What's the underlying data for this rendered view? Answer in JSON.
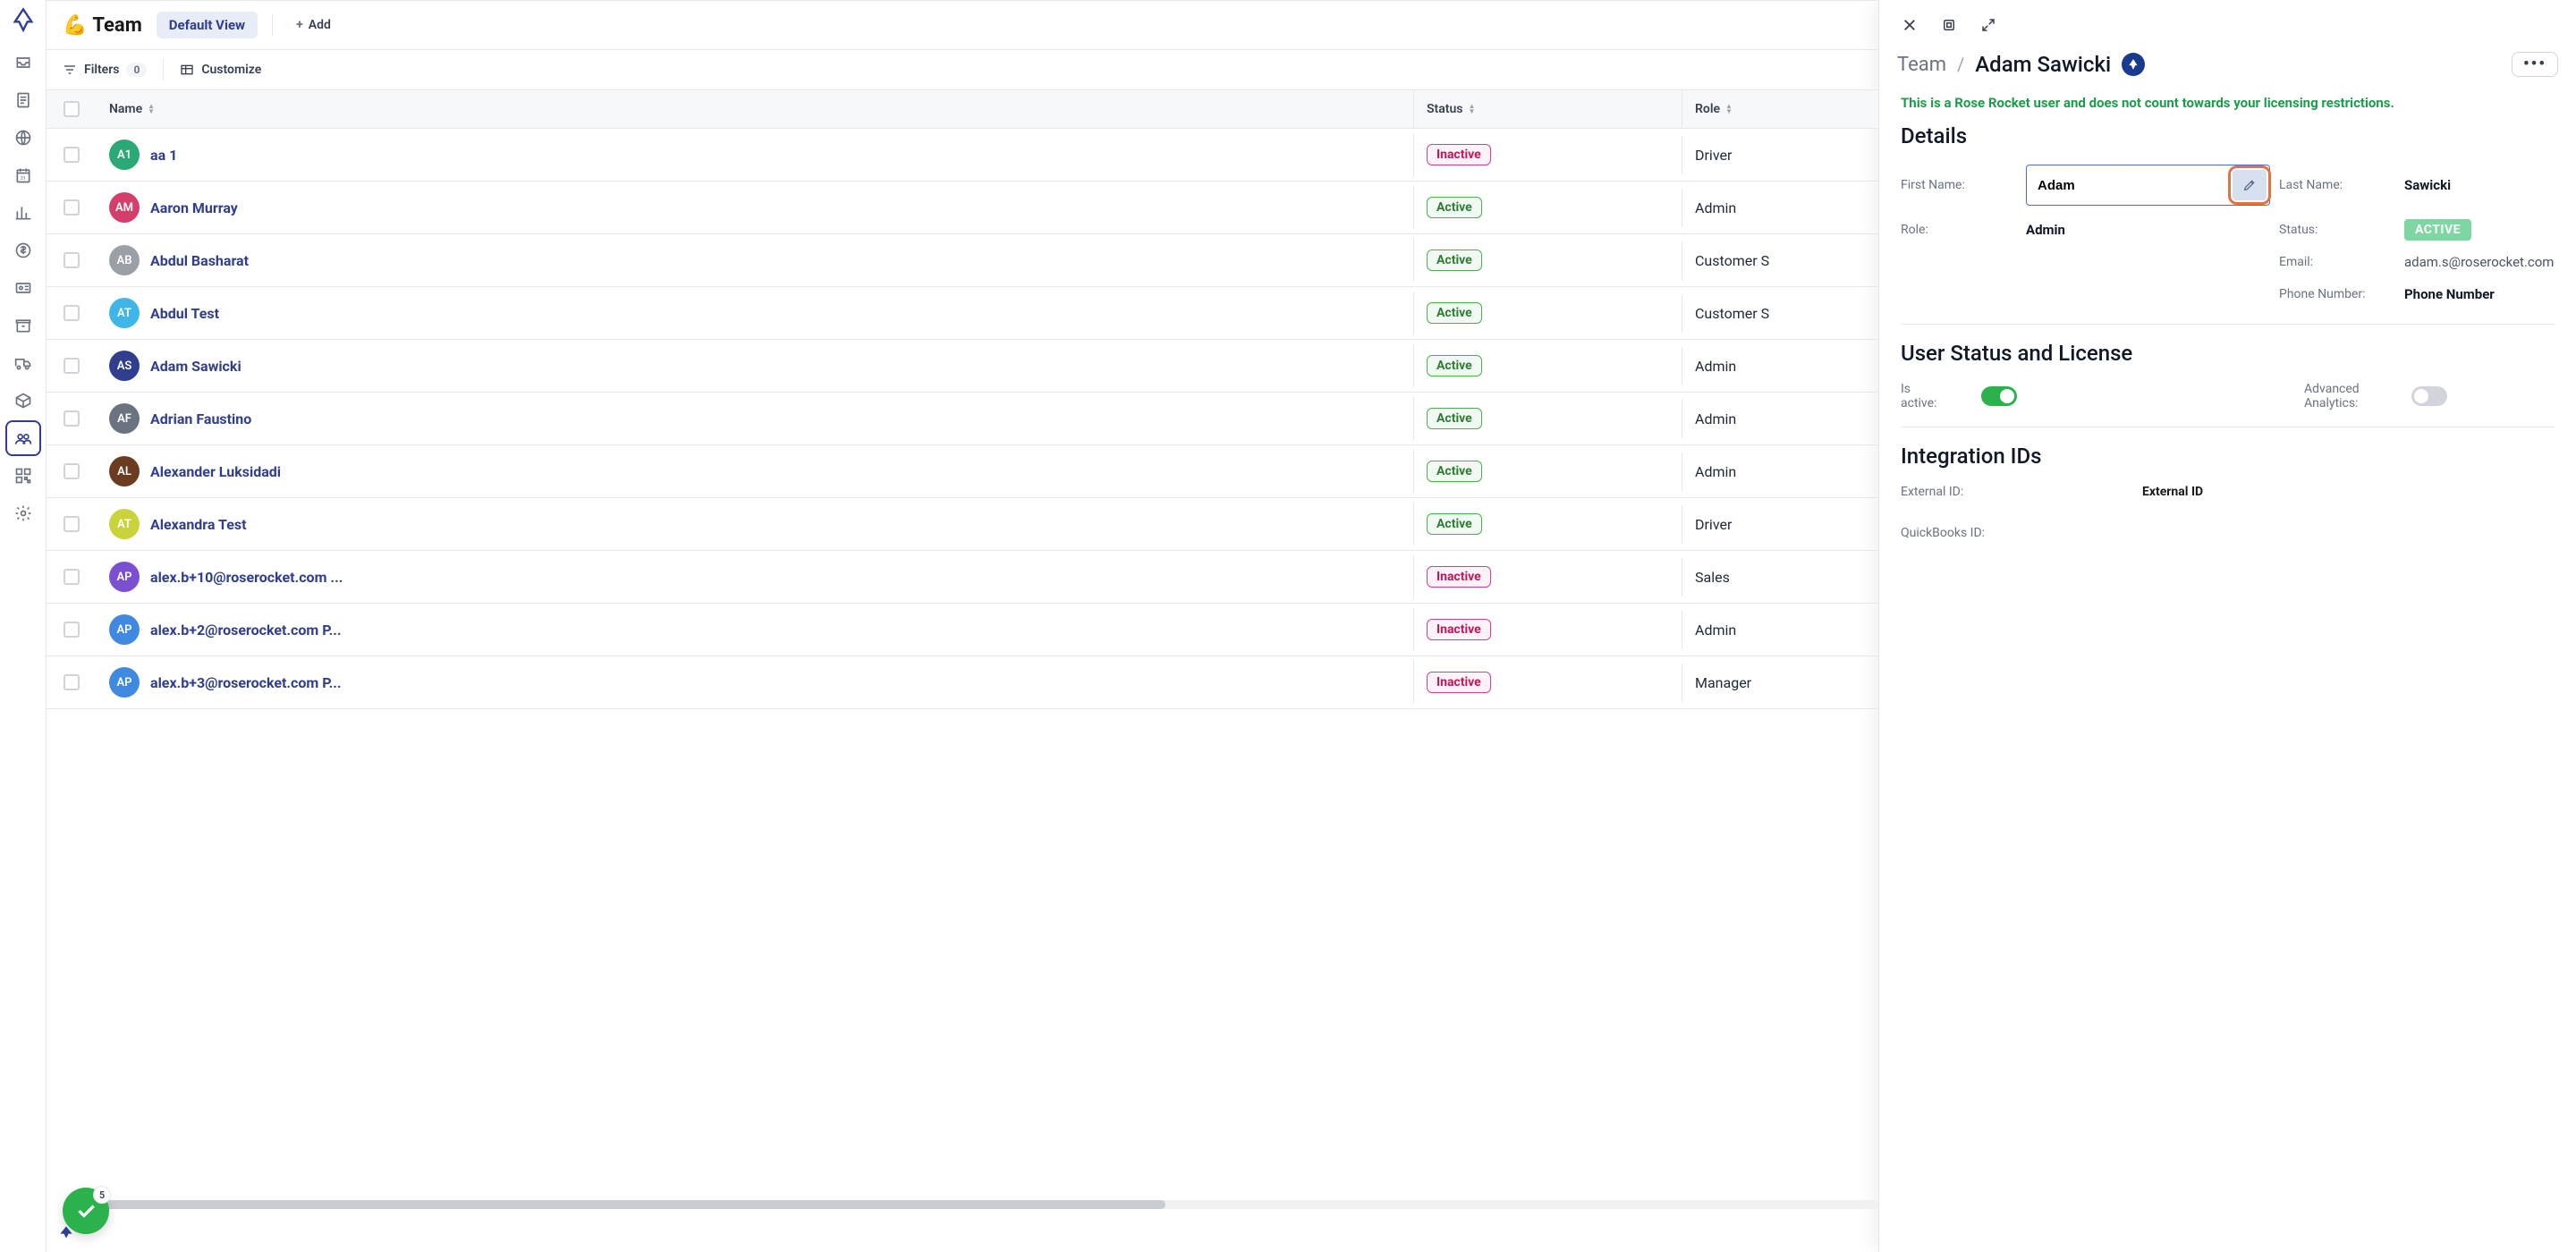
{
  "page": {
    "emoji": "💪",
    "title": "Team",
    "view": "Default View",
    "add": "Add"
  },
  "toolbar": {
    "filters": "Filters",
    "filters_count": "0",
    "customize": "Customize"
  },
  "columns": {
    "name": "Name",
    "status": "Status",
    "role": "Role"
  },
  "rows": [
    {
      "initials": "A1",
      "color": "#2aa876",
      "name": "aa 1",
      "status": "Inactive",
      "role": "Driver"
    },
    {
      "initials": "AM",
      "color": "#d33f6a",
      "name": "Aaron Murray",
      "status": "Active",
      "role": "Admin"
    },
    {
      "initials": "AB",
      "color": "#9aa0a6",
      "name": "Abdul Basharat",
      "status": "Active",
      "role": "Customer S"
    },
    {
      "initials": "AT",
      "color": "#3fb6e8",
      "name": "Abdul Test",
      "status": "Active",
      "role": "Customer S"
    },
    {
      "initials": "AS",
      "color": "#2f3e8f",
      "name": "Adam Sawicki",
      "status": "Active",
      "role": "Admin"
    },
    {
      "initials": "AF",
      "color": "#6b7280",
      "name": "Adrian Faustino",
      "status": "Active",
      "role": "Admin"
    },
    {
      "initials": "AL",
      "color": "#6b3c1f",
      "name": "Alexander Luksidadi",
      "status": "Active",
      "role": "Admin"
    },
    {
      "initials": "AT",
      "color": "#c8d43a",
      "name": "Alexandra Test",
      "status": "Active",
      "role": "Driver"
    },
    {
      "initials": "AP",
      "color": "#7b4fd1",
      "name": "alex.b+10@roserocket.com ...",
      "status": "Inactive",
      "role": "Sales"
    },
    {
      "initials": "AP",
      "color": "#3f8ae0",
      "name": "alex.b+2@roserocket.com P...",
      "status": "Inactive",
      "role": "Admin"
    },
    {
      "initials": "AP",
      "color": "#3f8ae0",
      "name": "alex.b+3@roserocket.com P...",
      "status": "Inactive",
      "role": "Manager"
    }
  ],
  "float_count": "5",
  "panel": {
    "crumb": "Team",
    "title": "Adam Sawicki",
    "notice": "This is a Rose Rocket user and does not count towards your licensing restrictions.",
    "sections": {
      "details": "Details",
      "license": "User Status and License",
      "integration": "Integration IDs"
    },
    "details": {
      "first_name_lbl": "First Name:",
      "first_name": "Adam",
      "last_name_lbl": "Last Name:",
      "last_name": "Sawicki",
      "role_lbl": "Role:",
      "role": "Admin",
      "status_lbl": "Status:",
      "status": "ACTIVE",
      "email_lbl": "Email:",
      "email": "adam.s@roserocket.com",
      "phone_lbl": "Phone Number:",
      "phone": "Phone Number"
    },
    "license": {
      "is_active_lbl": "Is active:",
      "advanced_lbl": "Advanced Analytics:"
    },
    "integration": {
      "external_lbl": "External ID:",
      "external_val": "External ID",
      "qb_lbl": "QuickBooks ID:"
    }
  }
}
